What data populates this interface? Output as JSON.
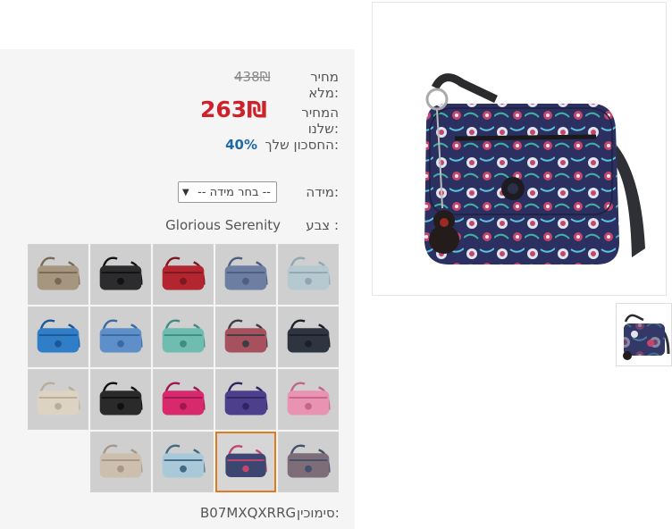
{
  "pricing": {
    "full_price_label": "מחיר מלא:",
    "full_price_value": "438₪",
    "our_price_label": "המחיר שלנו:",
    "our_price_value": "263₪",
    "savings_label": "החסכון שלך:",
    "savings_value": "40%"
  },
  "size": {
    "label": "מידה:",
    "selected": "-- בחר מידה --"
  },
  "color": {
    "label": "צבע :",
    "selected": "Glorious Serenity"
  },
  "sku": {
    "label": "סימוכין:",
    "value": "B07MXQXRRG"
  },
  "swatches": [
    {
      "name": "swatch-light-blue",
      "color": "#b7c9d0",
      "accent": "#8fa7b2"
    },
    {
      "name": "swatch-slate-blue",
      "color": "#6c7fa3",
      "accent": "#4d5e80"
    },
    {
      "name": "swatch-red",
      "color": "#b32630",
      "accent": "#7c1820"
    },
    {
      "name": "swatch-black",
      "color": "#2c2c2e",
      "accent": "#111"
    },
    {
      "name": "swatch-gold",
      "color": "#a69680",
      "accent": "#776956"
    },
    {
      "name": "swatch-navy",
      "color": "#2f3540",
      "accent": "#1b1f27"
    },
    {
      "name": "swatch-pattern-stripes",
      "color": "#a7505e",
      "accent": "#3a3f46"
    },
    {
      "name": "swatch-teal",
      "color": "#6fbcb1",
      "accent": "#3f8c82"
    },
    {
      "name": "swatch-cornflower",
      "color": "#5f8fc8",
      "accent": "#3a6aa3"
    },
    {
      "name": "swatch-bright-blue",
      "color": "#2f7ec7",
      "accent": "#1c5796"
    },
    {
      "name": "swatch-pink",
      "color": "#e893b1",
      "accent": "#c66489"
    },
    {
      "name": "swatch-purple",
      "color": "#4d3f8c",
      "accent": "#2f2560"
    },
    {
      "name": "swatch-magenta",
      "color": "#d8296d",
      "accent": "#9d1850"
    },
    {
      "name": "swatch-black-2",
      "color": "#2a2a2a",
      "accent": "#101010"
    },
    {
      "name": "swatch-cream",
      "color": "#ddd3c2",
      "accent": "#b9ad98"
    },
    {
      "name": "swatch-pattern-multi",
      "color": "#7d6d78",
      "accent": "#43506b"
    },
    {
      "name": "swatch-glorious-serenity",
      "color": "#3c4670",
      "accent": "#c2466e",
      "selected": true
    },
    {
      "name": "swatch-pattern-dots",
      "color": "#a9c8d8",
      "accent": "#416a87"
    },
    {
      "name": "swatch-beige",
      "color": "#cdbfae",
      "accent": "#a7978a"
    }
  ],
  "colors": {
    "panel_bg": "#f5f5f5",
    "price_red": "#d0202a",
    "savings_blue": "#1f6aa5",
    "selected_border": "#e07a1c"
  }
}
